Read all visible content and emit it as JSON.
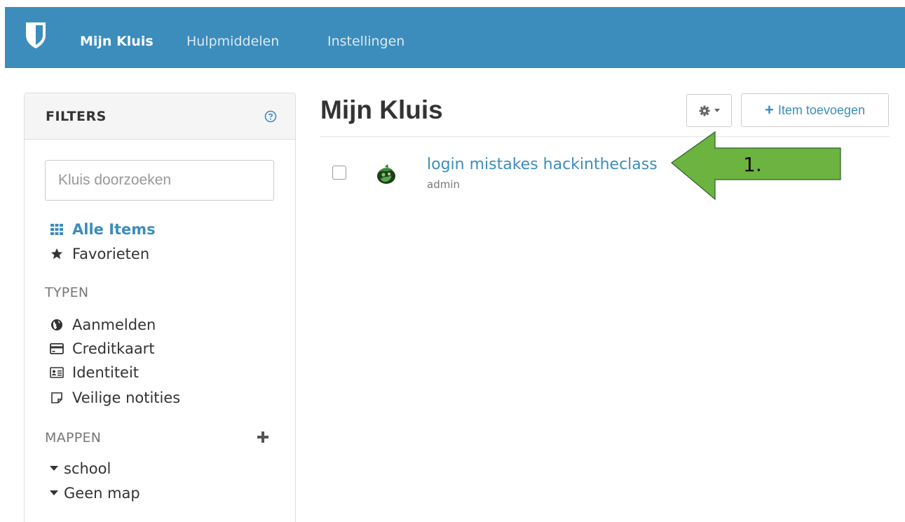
{
  "navbar": {
    "logo_icon": "shield-icon",
    "links": [
      {
        "label": "Mijn Kluis",
        "active": true
      },
      {
        "label": "Hulpmiddelen",
        "active": false
      },
      {
        "label": "Instellingen",
        "active": false
      }
    ]
  },
  "sidebar": {
    "title": "FILTERS",
    "help_icon": "question-circle-icon",
    "search_placeholder": "Kluis doorzoeken",
    "all_items": {
      "label": "Alle Items",
      "icon": "grid-icon"
    },
    "favorites": {
      "label": "Favorieten",
      "icon": "star-icon"
    },
    "types_heading": "TYPEN",
    "types": [
      {
        "label": "Aanmelden",
        "icon": "globe-icon"
      },
      {
        "label": "Creditkaart",
        "icon": "credit-card-icon"
      },
      {
        "label": "Identiteit",
        "icon": "id-card-icon"
      },
      {
        "label": "Veilige notities",
        "icon": "sticky-note-icon"
      }
    ],
    "folders_heading": "MAPPEN",
    "add_folder_icon": "plus-icon",
    "folders": [
      {
        "label": "school",
        "icon": "caret-down-icon"
      },
      {
        "label": "Geen map",
        "icon": "caret-down-icon"
      }
    ]
  },
  "main": {
    "title": "Mijn Kluis",
    "settings_icon": "gear-icon",
    "add_button": "Item toevoegen",
    "items": [
      {
        "name": "login mistakes hackintheclass",
        "username": "admin"
      }
    ]
  },
  "annotation": {
    "label": "1.",
    "color": "#6db33f"
  },
  "colors": {
    "navbar": "#3c8dbc",
    "link": "#3c8dbc",
    "arrow": "#6db33f"
  }
}
